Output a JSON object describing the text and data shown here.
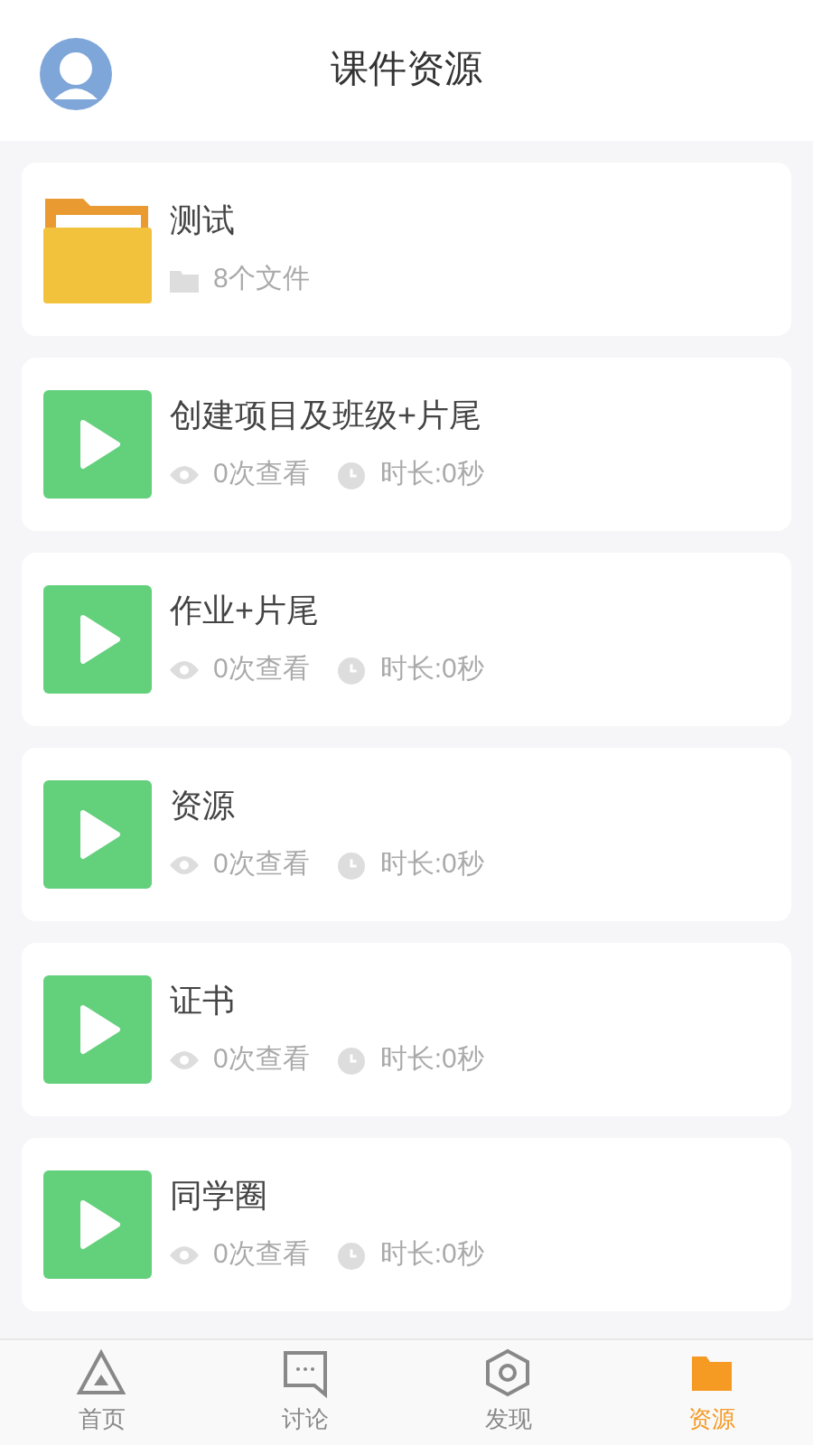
{
  "header": {
    "title": "课件资源"
  },
  "items": [
    {
      "kind": "folder",
      "title": "测试",
      "count": "8个文件"
    },
    {
      "kind": "video",
      "title": "创建项目及班级+片尾",
      "views": "0次查看",
      "duration": "时长:0秒"
    },
    {
      "kind": "video",
      "title": "作业+片尾",
      "views": "0次查看",
      "duration": "时长:0秒"
    },
    {
      "kind": "video",
      "title": "资源",
      "views": "0次查看",
      "duration": "时长:0秒"
    },
    {
      "kind": "video",
      "title": "证书",
      "views": "0次查看",
      "duration": "时长:0秒"
    },
    {
      "kind": "video",
      "title": "同学圈",
      "views": "0次查看",
      "duration": "时长:0秒"
    }
  ],
  "tabs": [
    {
      "label": "首页",
      "selected": false
    },
    {
      "label": "讨论",
      "selected": false
    },
    {
      "label": "发现",
      "selected": false
    },
    {
      "label": "资源",
      "selected": true
    }
  ]
}
